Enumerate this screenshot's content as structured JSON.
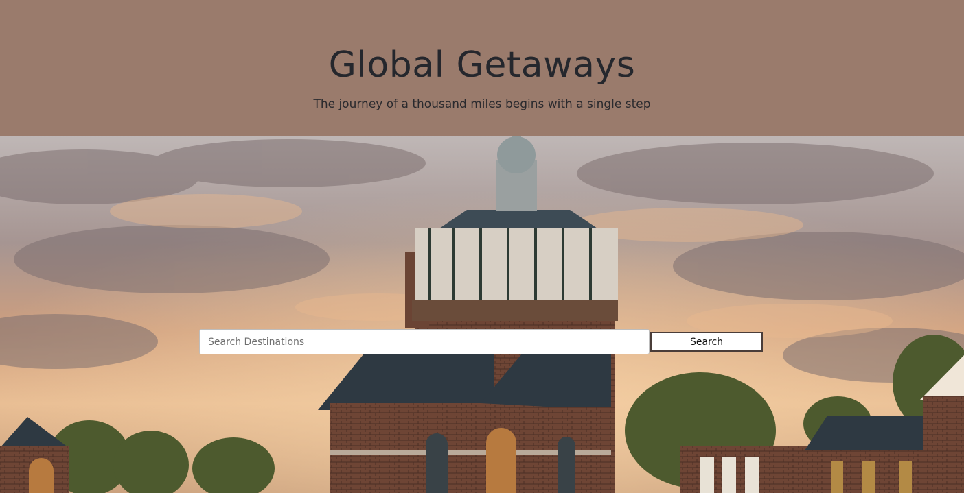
{
  "header": {
    "title": "Global Getaways",
    "tagline": "The journey of a thousand miles begins with a single step"
  },
  "hero": {
    "image_subject": "water tower and brick buildings under a cloudy sunset sky"
  },
  "search": {
    "placeholder": "Search Destinations",
    "value": "",
    "button_label": "Search"
  },
  "colors": {
    "header_background": "#9a7b6c",
    "title_text": "#25272d",
    "button_border": "#4a3d39"
  }
}
